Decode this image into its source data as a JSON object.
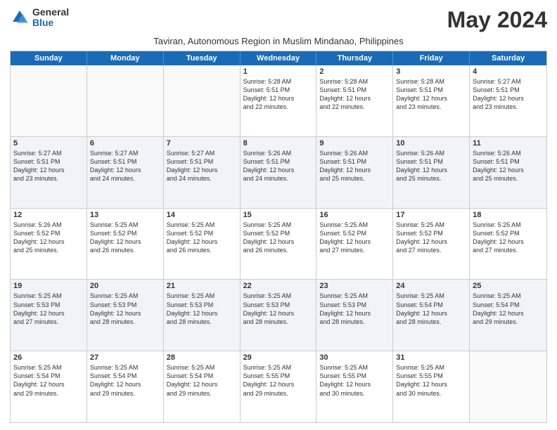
{
  "logo": {
    "general": "General",
    "blue": "Blue"
  },
  "title": "May 2024",
  "subtitle": "Taviran, Autonomous Region in Muslim Mindanao, Philippines",
  "weekdays": [
    "Sunday",
    "Monday",
    "Tuesday",
    "Wednesday",
    "Thursday",
    "Friday",
    "Saturday"
  ],
  "rows": [
    [
      {
        "day": "",
        "info": ""
      },
      {
        "day": "",
        "info": ""
      },
      {
        "day": "",
        "info": ""
      },
      {
        "day": "1",
        "info": "Sunrise: 5:28 AM\nSunset: 5:51 PM\nDaylight: 12 hours\nand 22 minutes."
      },
      {
        "day": "2",
        "info": "Sunrise: 5:28 AM\nSunset: 5:51 PM\nDaylight: 12 hours\nand 22 minutes."
      },
      {
        "day": "3",
        "info": "Sunrise: 5:28 AM\nSunset: 5:51 PM\nDaylight: 12 hours\nand 23 minutes."
      },
      {
        "day": "4",
        "info": "Sunrise: 5:27 AM\nSunset: 5:51 PM\nDaylight: 12 hours\nand 23 minutes."
      }
    ],
    [
      {
        "day": "5",
        "info": "Sunrise: 5:27 AM\nSunset: 5:51 PM\nDaylight: 12 hours\nand 23 minutes."
      },
      {
        "day": "6",
        "info": "Sunrise: 5:27 AM\nSunset: 5:51 PM\nDaylight: 12 hours\nand 24 minutes."
      },
      {
        "day": "7",
        "info": "Sunrise: 5:27 AM\nSunset: 5:51 PM\nDaylight: 12 hours\nand 24 minutes."
      },
      {
        "day": "8",
        "info": "Sunrise: 5:26 AM\nSunset: 5:51 PM\nDaylight: 12 hours\nand 24 minutes."
      },
      {
        "day": "9",
        "info": "Sunrise: 5:26 AM\nSunset: 5:51 PM\nDaylight: 12 hours\nand 25 minutes."
      },
      {
        "day": "10",
        "info": "Sunrise: 5:26 AM\nSunset: 5:51 PM\nDaylight: 12 hours\nand 25 minutes."
      },
      {
        "day": "11",
        "info": "Sunrise: 5:26 AM\nSunset: 5:51 PM\nDaylight: 12 hours\nand 25 minutes."
      }
    ],
    [
      {
        "day": "12",
        "info": "Sunrise: 5:26 AM\nSunset: 5:52 PM\nDaylight: 12 hours\nand 25 minutes."
      },
      {
        "day": "13",
        "info": "Sunrise: 5:25 AM\nSunset: 5:52 PM\nDaylight: 12 hours\nand 26 minutes."
      },
      {
        "day": "14",
        "info": "Sunrise: 5:25 AM\nSunset: 5:52 PM\nDaylight: 12 hours\nand 26 minutes."
      },
      {
        "day": "15",
        "info": "Sunrise: 5:25 AM\nSunset: 5:52 PM\nDaylight: 12 hours\nand 26 minutes."
      },
      {
        "day": "16",
        "info": "Sunrise: 5:25 AM\nSunset: 5:52 PM\nDaylight: 12 hours\nand 27 minutes."
      },
      {
        "day": "17",
        "info": "Sunrise: 5:25 AM\nSunset: 5:52 PM\nDaylight: 12 hours\nand 27 minutes."
      },
      {
        "day": "18",
        "info": "Sunrise: 5:25 AM\nSunset: 5:52 PM\nDaylight: 12 hours\nand 27 minutes."
      }
    ],
    [
      {
        "day": "19",
        "info": "Sunrise: 5:25 AM\nSunset: 5:53 PM\nDaylight: 12 hours\nand 27 minutes."
      },
      {
        "day": "20",
        "info": "Sunrise: 5:25 AM\nSunset: 5:53 PM\nDaylight: 12 hours\nand 28 minutes."
      },
      {
        "day": "21",
        "info": "Sunrise: 5:25 AM\nSunset: 5:53 PM\nDaylight: 12 hours\nand 28 minutes."
      },
      {
        "day": "22",
        "info": "Sunrise: 5:25 AM\nSunset: 5:53 PM\nDaylight: 12 hours\nand 28 minutes."
      },
      {
        "day": "23",
        "info": "Sunrise: 5:25 AM\nSunset: 5:53 PM\nDaylight: 12 hours\nand 28 minutes."
      },
      {
        "day": "24",
        "info": "Sunrise: 5:25 AM\nSunset: 5:54 PM\nDaylight: 12 hours\nand 28 minutes."
      },
      {
        "day": "25",
        "info": "Sunrise: 5:25 AM\nSunset: 5:54 PM\nDaylight: 12 hours\nand 29 minutes."
      }
    ],
    [
      {
        "day": "26",
        "info": "Sunrise: 5:25 AM\nSunset: 5:54 PM\nDaylight: 12 hours\nand 29 minutes."
      },
      {
        "day": "27",
        "info": "Sunrise: 5:25 AM\nSunset: 5:54 PM\nDaylight: 12 hours\nand 29 minutes."
      },
      {
        "day": "28",
        "info": "Sunrise: 5:25 AM\nSunset: 5:54 PM\nDaylight: 12 hours\nand 29 minutes."
      },
      {
        "day": "29",
        "info": "Sunrise: 5:25 AM\nSunset: 5:55 PM\nDaylight: 12 hours\nand 29 minutes."
      },
      {
        "day": "30",
        "info": "Sunrise: 5:25 AM\nSunset: 5:55 PM\nDaylight: 12 hours\nand 30 minutes."
      },
      {
        "day": "31",
        "info": "Sunrise: 5:25 AM\nSunset: 5:55 PM\nDaylight: 12 hours\nand 30 minutes."
      },
      {
        "day": "",
        "info": ""
      }
    ]
  ]
}
